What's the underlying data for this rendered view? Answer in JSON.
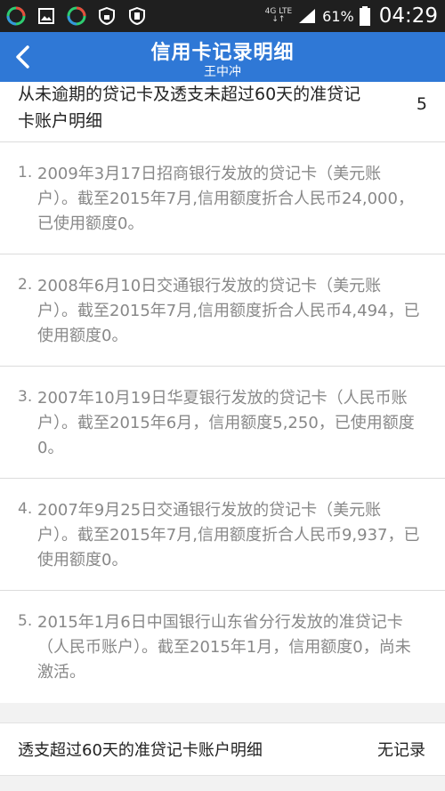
{
  "status_bar": {
    "network_top": "4G LTE",
    "network_bottom": "↓↑",
    "battery": "61%",
    "time": "04:29"
  },
  "header": {
    "title": "信用卡记录明细",
    "subtitle": "王中冲",
    "accent": "#2f78d6"
  },
  "section": {
    "title": "从未逾期的贷记卡及透支未超过60天的准贷记卡账户明细",
    "count": "5"
  },
  "records": [
    {
      "num": "1.",
      "text": "2009年3月17日招商银行发放的贷记卡（美元账户）。截至2015年7月,信用额度折合人民币24,000，已使用额度0。"
    },
    {
      "num": "2.",
      "text": "2008年6月10日交通银行发放的贷记卡（美元账户）。截至2015年7月,信用额度折合人民币4,494，已使用额度0。"
    },
    {
      "num": "3.",
      "text": "2007年10月19日华夏银行发放的贷记卡（人民币账户）。截至2015年6月，信用额度5,250，已使用额度0。"
    },
    {
      "num": "4.",
      "text": "2007年9月25日交通银行发放的贷记卡（美元账户）。截至2015年7月,信用额度折合人民币9,937，已使用额度0。"
    },
    {
      "num": "5.",
      "text": "2015年1月6日中国银行山东省分行发放的准贷记卡（人民币账户）。截至2015年1月，信用额度0，尚未激活。"
    }
  ],
  "overdue_section": {
    "label": "透支超过60天的准贷记卡账户明细",
    "value": "无记录"
  }
}
